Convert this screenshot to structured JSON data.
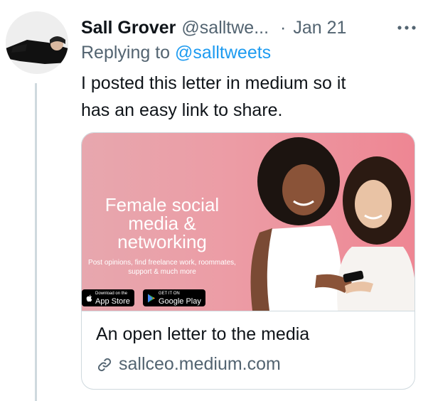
{
  "tweet": {
    "author_name": "Sall Grover",
    "author_handle": "@salltwe...",
    "separator": "·",
    "date": "Jan 21",
    "more_icon": "more-icon",
    "replying_prefix": "Replying to",
    "replying_handle": "@salltweets",
    "text_line1": "I posted this letter in medium so it",
    "text_line2": "has an easy link to share."
  },
  "card": {
    "image": {
      "headline_line1": "Female social",
      "headline_line2": "media &",
      "headline_line3": "networking",
      "subline1": "Post opinions, find freelance work, roommates,",
      "subline2": "support & much more",
      "app_store_small": "Download on the",
      "app_store_big": "App Store",
      "google_play_small": "GET IT ON",
      "google_play_big": "Google Play"
    },
    "title": "An open letter to the media",
    "domain": "sallceo.medium.com",
    "link_icon": "link-icon"
  },
  "colors": {
    "accent": "#1d9bf0",
    "secondary_text": "#536471",
    "card_pink": "#ec9ca5",
    "border": "#cfd9de"
  }
}
